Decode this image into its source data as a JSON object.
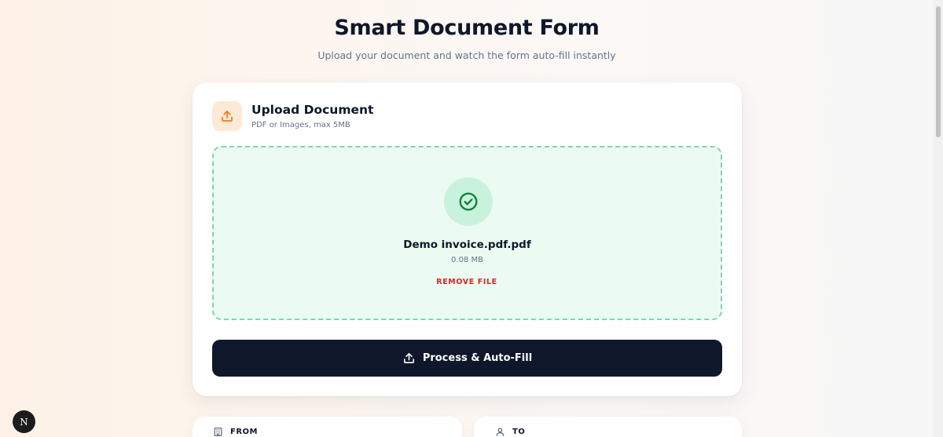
{
  "header": {
    "title": "Smart Document Form",
    "subtitle": "Upload your document and watch the form auto-fill instantly"
  },
  "upload_card": {
    "title": "Upload Document",
    "subtitle": "PDF or Images, max 5MB",
    "icon": "upload-icon"
  },
  "uploaded_file": {
    "name": "Demo invoice.pdf.pdf",
    "size": "0.08 MB",
    "status_icon": "check-circle-icon",
    "remove_label": "REMOVE FILE"
  },
  "process_button": {
    "label": "Process & Auto-Fill",
    "icon": "upload-icon"
  },
  "sections": {
    "from_label": "FROM",
    "from_icon": "building-icon",
    "to_label": "TO",
    "to_icon": "user-icon"
  },
  "dev_badge": {
    "label": "N"
  },
  "colors": {
    "accent_orange": "#f97316",
    "success_green": "#16a34a",
    "danger_red": "#dc2626",
    "primary_dark": "#0f172a"
  }
}
